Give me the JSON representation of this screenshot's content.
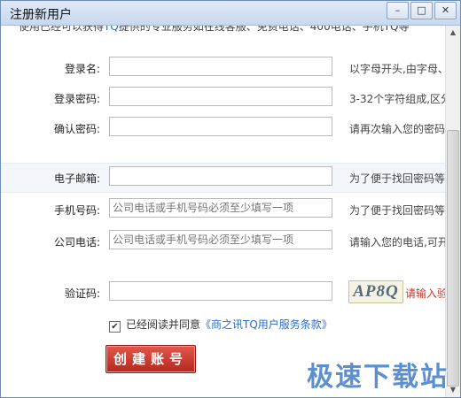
{
  "window": {
    "title": "注册新用户"
  },
  "top_notice": {
    "prefix": "使用已经可以获得",
    "brand": "TQ",
    "suffix": "提供的专业服务如在线客服、免费电话、400电话、手机TQ等"
  },
  "form": {
    "login_name": {
      "label": "登录名:",
      "value": "",
      "hint": "以字母开头,由字母、"
    },
    "password": {
      "label": "登录密码:",
      "value": "",
      "hint": "3-32个字符组成,区分"
    },
    "confirm_password": {
      "label": "确认密码:",
      "value": "",
      "hint": "请再次输入您的密码"
    },
    "email": {
      "label": "电子邮箱:",
      "value": "",
      "hint": "为了便于找回密码等"
    },
    "mobile": {
      "label": "手机号码:",
      "placeholder": "公司电话或手机号码必须至少填写一项",
      "hint": "为了便于找回密码等"
    },
    "company_phone": {
      "label": "公司电话:",
      "placeholder": "公司电话或手机号码必须至少填写一项",
      "hint": "请输入您的电话,可开"
    },
    "captcha": {
      "label": "验证码:",
      "value": "",
      "image_text": "AP8Q",
      "hint": "请输入验"
    }
  },
  "agreement": {
    "checked_mark": "✔",
    "text": "已经阅读并同意",
    "link": "《商之讯TQ用户服务条款》"
  },
  "buttons": {
    "create": "创建账号",
    "minimize": "–",
    "maximize": "□",
    "close": "✕"
  },
  "scrollbar": {
    "up": "▲",
    "down": "▼"
  },
  "watermark": "极速下载站",
  "colors": {
    "accent": "#2a6fc9",
    "button": "#c8352a",
    "hint_red": "#c0392b"
  }
}
